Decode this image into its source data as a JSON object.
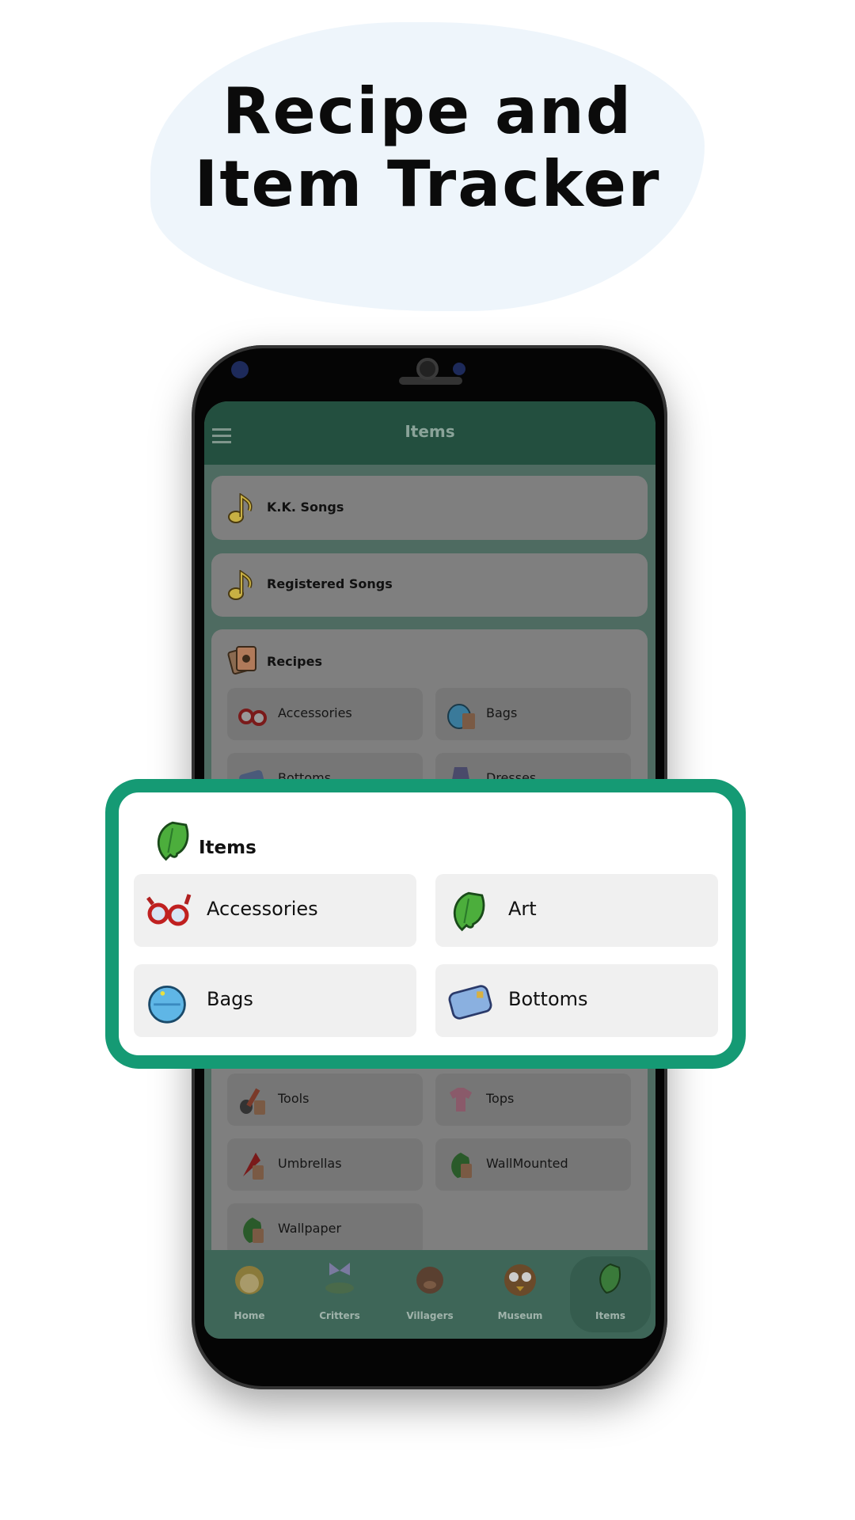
{
  "headline": {
    "line1": "Recipe and",
    "line2": "Item Tracker"
  },
  "colors": {
    "accent": "#159a74",
    "appbar": "#234f3f"
  },
  "app": {
    "title": "Items",
    "menu_icon": "hamburger-icon",
    "sections": [
      {
        "label": "K.K. Songs",
        "icon": "music-note-icon"
      },
      {
        "label": "Registered Songs",
        "icon": "music-note-icon"
      }
    ],
    "recipes": {
      "label": "Recipes",
      "icon": "recipe-card-icon",
      "top": [
        {
          "label": "Accessories"
        },
        {
          "label": "Bags"
        },
        {
          "label": "Bottoms"
        },
        {
          "label": "Dresses"
        }
      ],
      "bottom": [
        {
          "label": "Tools"
        },
        {
          "label": "Tops"
        },
        {
          "label": "Umbrellas"
        },
        {
          "label": "WallMounted"
        },
        {
          "label": "Wallpaper"
        }
      ]
    },
    "nav": [
      {
        "label": "Home"
      },
      {
        "label": "Critters"
      },
      {
        "label": "Villagers"
      },
      {
        "label": "Museum"
      },
      {
        "label": "Items",
        "selected": true
      }
    ]
  },
  "highlight": {
    "title": "Items",
    "icon": "leaf-icon",
    "items": [
      {
        "label": "Accessories",
        "icon": "glasses-icon"
      },
      {
        "label": "Art",
        "icon": "leaf-icon"
      },
      {
        "label": "Bags",
        "icon": "backpack-icon"
      },
      {
        "label": "Bottoms",
        "icon": "pants-icon"
      }
    ]
  }
}
